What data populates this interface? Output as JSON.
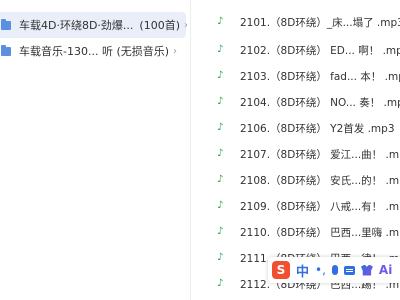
{
  "folders": [
    {
      "label": "车载4D·环绕8D·劲爆...",
      "count": "(100首)",
      "selected": true
    },
    {
      "label": "车载音乐-130... 听 (无损音乐)",
      "count": "",
      "selected": false
    }
  ],
  "files": [
    "2101.（8D环绕）_床...塌了 .mp3",
    "2102.（8D环绕） ED... 啊！ .mp3",
    "2103.（8D环绕） fad... 本！ .mp3",
    "2104.（8D环绕） NO... 奏！ .mp3",
    "2106.（8D环绕） Y2首发 .mp3",
    "2107.（8D环绕） 爱江...曲！ .mp3",
    "2108.（8D环绕） 安氏...的！ .mp3",
    "2109.（8D环绕） 八戒...有！ .mp3",
    "2110.（8D环绕） 巴西...里嗨 .mp3",
    "2111.（8D环绕） 巴西...律！ .mp3",
    "2112.（8D环绕） 巴西...踢！ .mp3"
  ],
  "ime_toolbar": {
    "logo": "S",
    "lang": "中",
    "punct": "•,",
    "ai": "Ai"
  },
  "icons": {
    "folder": "folder-icon",
    "file": "music-note-icon",
    "chevron": "chevron-right-icon"
  },
  "colors": {
    "selected_bg": "#e9eef9",
    "folder_blue": "#5b8fe0",
    "music_green": "#2fa24f",
    "ime_orange": "#f0502f",
    "ime_blue": "#2f6fe0"
  }
}
